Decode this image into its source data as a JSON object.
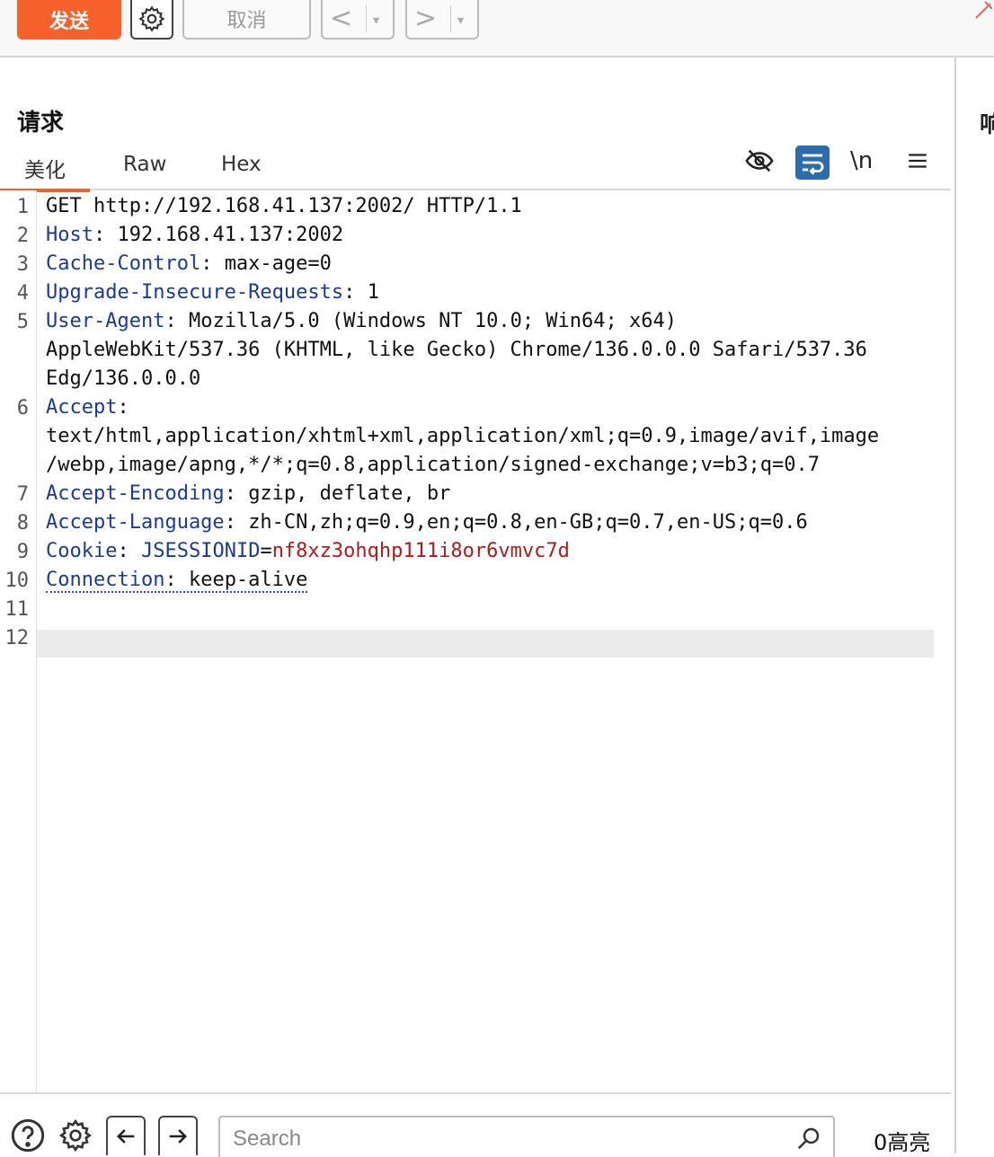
{
  "toolbar": {
    "send_label": "发送",
    "cancel_label": "取消",
    "prev_glyph": "<",
    "next_glyph": ">",
    "dropdown_glyph": "▾"
  },
  "request": {
    "title": "请求",
    "tabs": [
      {
        "label": "美化",
        "active": true
      },
      {
        "label": "Raw",
        "active": false
      },
      {
        "label": "Hex",
        "active": false
      }
    ],
    "newline_toggle_label": "\\n",
    "lines": [
      {
        "n": "1",
        "text": "GET http://192.168.41.137:2002/ HTTP/1.1"
      },
      {
        "n": "2",
        "key": "Host",
        "sep": ": ",
        "value": "192.168.41.137:2002"
      },
      {
        "n": "3",
        "key": "Cache-Control",
        "sep": ": ",
        "value": "max-age=0"
      },
      {
        "n": "4",
        "key": "Upgrade-Insecure-Requests",
        "sep": ": ",
        "value": "1"
      },
      {
        "n": "5",
        "key": "User-Agent",
        "sep": ": ",
        "value": "Mozilla/5.0 (Windows NT 10.0; Win64; x64)",
        "cont1": "AppleWebKit/537.36 (KHTML, like Gecko) Chrome/136.0.0.0 Safari/537.36",
        "cont2": "Edg/136.0.0.0"
      },
      {
        "n": "6",
        "key": "Accept",
        "sep": ":",
        "cont1": "text/html,application/xhtml+xml,application/xml;q=0.9,image/avif,image",
        "cont2": "/webp,image/apng,*/*;q=0.8,application/signed-exchange;v=b3;q=0.7"
      },
      {
        "n": "7",
        "key": "Accept-Encoding",
        "sep": ": ",
        "value": "gzip, deflate, br"
      },
      {
        "n": "8",
        "key": "Accept-Language",
        "sep": ": ",
        "value": "zh-CN,zh;q=0.9,en;q=0.8,en-GB;q=0.7,en-US;q=0.6"
      },
      {
        "n": "9",
        "key": "Cookie",
        "sep": ": ",
        "cookie_name": "JSESSIONID",
        "cookie_eq": "=",
        "cookie_value": "nf8xz3ohqhp111i8or6vmvc7d"
      },
      {
        "n": "10",
        "key": "Connection",
        "sep": ": ",
        "value": "keep-alive"
      },
      {
        "n": "11"
      },
      {
        "n": "12"
      }
    ]
  },
  "response": {
    "title_partial": "响"
  },
  "bottom": {
    "search_placeholder": "Search",
    "highlight_count": "0高亮"
  },
  "colors": {
    "accent": "#f5602b",
    "header_key": "#1a3a9a",
    "cookie_value": "#b11a1a",
    "wrap_toggle": "#2b6cb0"
  }
}
